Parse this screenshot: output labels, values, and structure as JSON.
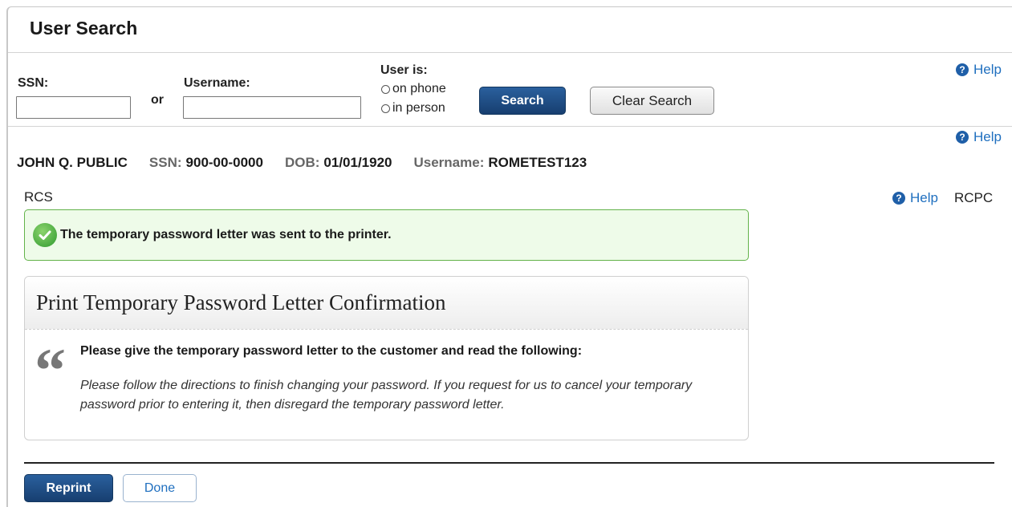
{
  "header": {
    "title": "User Search"
  },
  "search": {
    "ssn_label": "SSN:",
    "ssn_value": "",
    "or_label": "or",
    "username_label": "Username:",
    "username_value": "",
    "user_is_label": "User is:",
    "options": [
      "on phone",
      "in person"
    ],
    "search_label": "Search",
    "clear_label": "Clear Search"
  },
  "help_label": "Help",
  "help_icon_glyph": "?",
  "customer": {
    "name": "JOHN Q. PUBLIC",
    "ssn_label": "SSN:",
    "ssn": "900-00-0000",
    "dob_label": "DOB:",
    "dob": "01/01/1920",
    "username_label": "Username:",
    "username": "ROMETEST123"
  },
  "section_left": "RCS",
  "section_right": "RCPC",
  "alert": {
    "icon": "check-circle-icon",
    "message": "The temporary password letter was sent to the printer."
  },
  "panel": {
    "title": "Print Temporary Password Letter Confirmation",
    "quote_glyph": "“",
    "lead": "Please give the temporary password letter to the customer and read the following:",
    "body": "Please follow the directions to finish changing your password. If you request for us to cancel your temporary password prior to entering it, then disregard the temporary password letter."
  },
  "actions": {
    "reprint_label": "Reprint",
    "done_label": "Done"
  },
  "colors": {
    "primary": "#1e4f86",
    "success_border": "#63b34a",
    "success_bg": "#eefbe9",
    "link": "#1f6fbf"
  }
}
